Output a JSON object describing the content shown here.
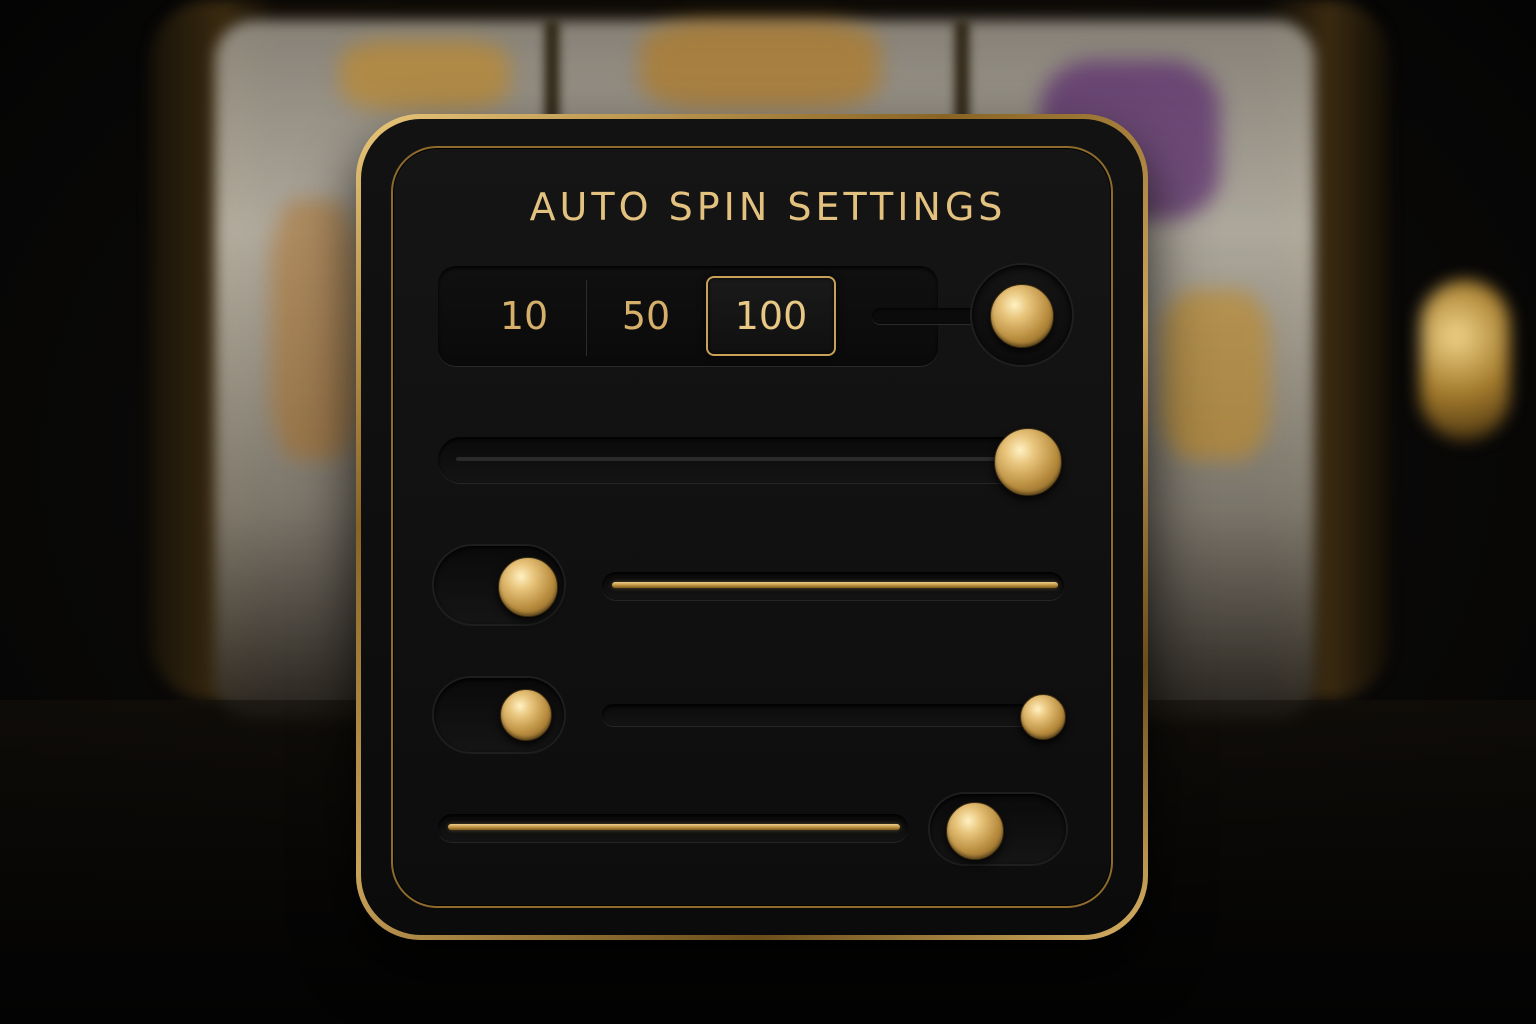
{
  "panel": {
    "title": "AUTO SPIN SETTINGS"
  },
  "spin_count": {
    "options": [
      "10",
      "50",
      "100"
    ],
    "selected": "100"
  },
  "controls": {
    "count_toggle_on": true,
    "slider_1_level": 0.95,
    "toggle_1_on": false,
    "toggle_2_on": false,
    "slider_2_level": 1.0,
    "toggle_3_on": false
  },
  "colors": {
    "accent_gold": "#e3c27f",
    "panel_black": "#111111"
  }
}
